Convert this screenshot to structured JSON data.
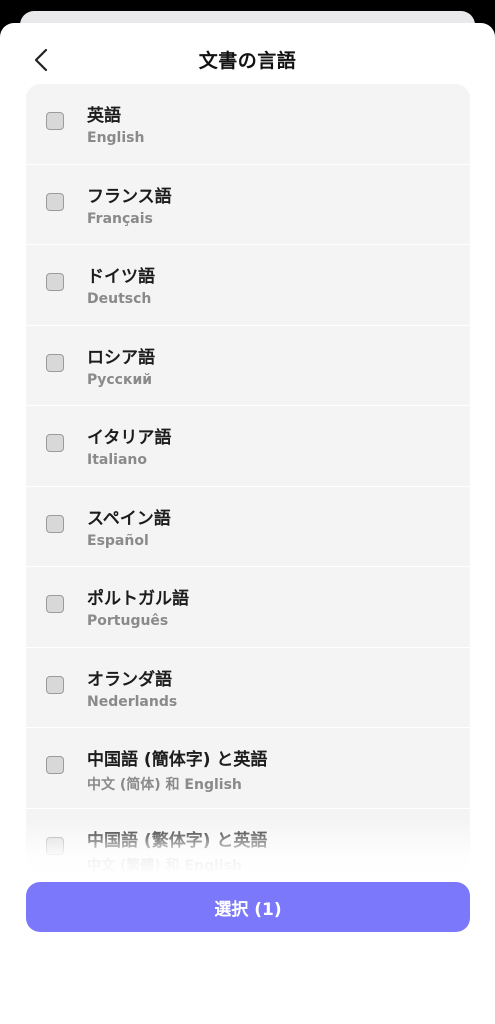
{
  "header": {
    "title": "文書の言語",
    "back_icon": "chevron-left-icon"
  },
  "languages": [
    {
      "name": "英語",
      "native": "English",
      "checked": false
    },
    {
      "name": "フランス語",
      "native": "Français",
      "checked": false
    },
    {
      "name": "ドイツ語",
      "native": "Deutsch",
      "checked": false
    },
    {
      "name": "ロシア語",
      "native": "Русский",
      "checked": false
    },
    {
      "name": "イタリア語",
      "native": "Italiano",
      "checked": false
    },
    {
      "name": "スペイン語",
      "native": "Español",
      "checked": false
    },
    {
      "name": "ポルトガル語",
      "native": "Português",
      "checked": false
    },
    {
      "name": "オランダ語",
      "native": "Nederlands",
      "checked": false
    },
    {
      "name": "中国語 (簡体字) と英語",
      "native": "中文 (简体) 和 English",
      "checked": false
    },
    {
      "name": "中国語 (繁体字) と英語",
      "native": "中文 (繁體) 和 English",
      "checked": false
    }
  ],
  "footer": {
    "select_label": "選択 (1)"
  },
  "colors": {
    "accent": "#7b78fb",
    "list_bg": "#f4f4f4"
  }
}
